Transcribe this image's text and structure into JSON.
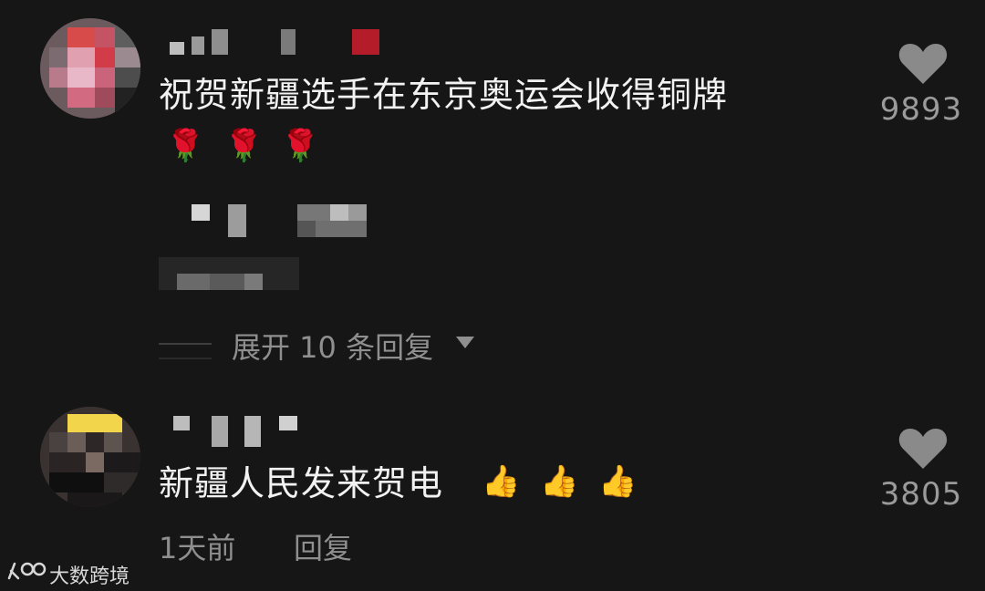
{
  "comments": [
    {
      "text": "祝贺新疆选手在东京奥运会收得铜牌",
      "emojis": [
        "🌹",
        "🌹",
        "🌹"
      ],
      "like_count": "9893",
      "replies_label": "展开 10 条回复"
    },
    {
      "text": "新疆人民发来贺电",
      "emojis": [
        "👍",
        "👍",
        "👍"
      ],
      "like_count": "3805",
      "time": "1天前",
      "reply_label": "回复"
    }
  ],
  "watermark": {
    "text": "大数跨境"
  },
  "icons": {
    "like": "heart-icon",
    "expand": "triangle-down-icon",
    "watermark_logo": "logo-icon"
  },
  "colors": {
    "background": "#161616",
    "text_primary": "#f2f2f2",
    "text_secondary": "#8f8f8f",
    "heart": "#8a8a8a"
  }
}
